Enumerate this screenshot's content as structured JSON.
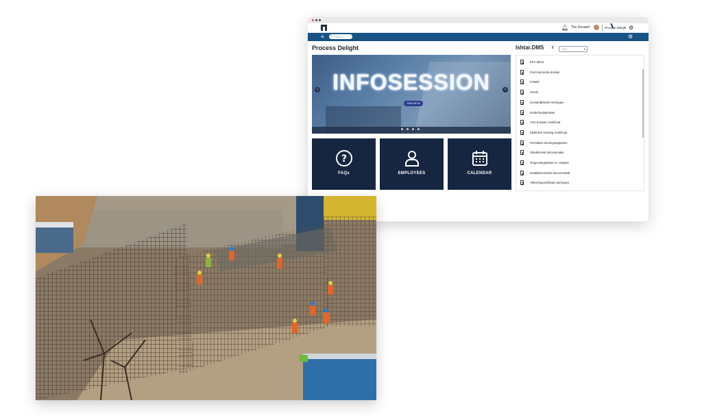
{
  "app": {
    "user_name": "Tim Govaert",
    "brand_small": "Process Delight",
    "search_placeholder": "Search..."
  },
  "main": {
    "page_title": "Process Delight",
    "banner": {
      "title": "INFOSESSION",
      "button_label": "SIGN ME IN",
      "slides": 4
    },
    "tiles": [
      {
        "label": "FAQs",
        "icon": "question-circle-icon"
      },
      {
        "label": "EMPLOYEES",
        "icon": "person-icon"
      },
      {
        "label": "CALENDAR",
        "icon": "calendar-icon"
      }
    ]
  },
  "dms": {
    "title": "Ishtar.DMS",
    "filter_placeholder": "Filter",
    "documents": [
      "EPC attest",
      "Post interventie dossier",
      "S-Build",
      "OVAM",
      "Gevaarlijkheids voertuigen",
      "Onderhoudsdossier",
      "CO2 Emissie Certificaat",
      "Elektrisch voertuig Certificaat",
      "Periodieke keuringsrapporten",
      "Shadehonist documentatie",
      "Ongevalregistratie en -analyse",
      "Kwaliteitscontrole documentatie",
      "Afleveringcertificaat voertuigen"
    ]
  },
  "colors": {
    "navbar": "#175385",
    "tile": "#172640"
  }
}
